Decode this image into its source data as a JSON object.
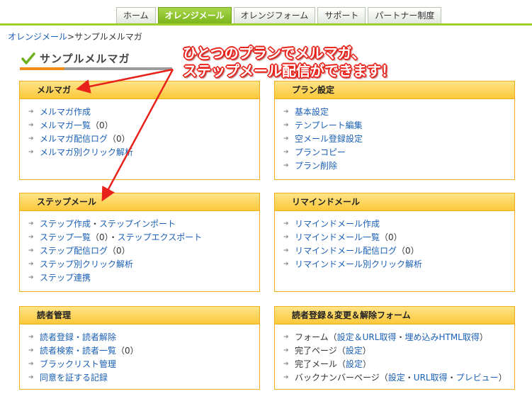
{
  "nav": {
    "tabs": [
      {
        "label": "ホーム"
      },
      {
        "label": "オレンジメール",
        "active": true
      },
      {
        "label": "オレンジフォーム"
      },
      {
        "label": "サポート"
      },
      {
        "label": "パートナー制度"
      }
    ]
  },
  "breadcrumb": {
    "root": "オレンジメール",
    "separator": ">",
    "current": "サンプルメルマガ"
  },
  "page": {
    "title": "サンプルメルマガ",
    "title_icon": "check-icon"
  },
  "annotation": {
    "line1": "ひとつのプランでメルマガ、",
    "line2": "ステップメール配信ができます！"
  },
  "panels": {
    "mailmag": {
      "title": "メルマガ",
      "items": [
        {
          "link": "メルマガ作成"
        },
        {
          "link": "メルマガ一覧",
          "suffix": "（0）"
        },
        {
          "link": "メルマガ配信ログ",
          "suffix": "（0）"
        },
        {
          "link": "メルマガ別クリック解析"
        }
      ]
    },
    "plan": {
      "title": "プラン設定",
      "items": [
        {
          "link": "基本設定"
        },
        {
          "link": "テンプレート編集"
        },
        {
          "link": "空メール登録設定"
        },
        {
          "link": "プランコピー"
        },
        {
          "link": "プラン削除"
        }
      ]
    },
    "step": {
      "title": "ステップメール",
      "items": [
        {
          "link": "ステップ作成",
          "mid": "・",
          "link2": "ステップインポート"
        },
        {
          "link": "ステップ一覧",
          "mid": "（0）・",
          "link2": "ステップエクスポート"
        },
        {
          "link": "ステップ配信ログ",
          "suffix": "（0）"
        },
        {
          "link": "ステップ別クリック解析"
        },
        {
          "link": "ステップ連携"
        }
      ]
    },
    "remind": {
      "title": "リマインドメール",
      "items": [
        {
          "link": "リマインドメール作成"
        },
        {
          "link": "リマインドメール一覧",
          "suffix": "（0）"
        },
        {
          "link": "リマインドメール配信ログ",
          "suffix": "（0）"
        },
        {
          "link": "リマインドメール別クリック解析"
        }
      ]
    },
    "readers": {
      "title": "読者管理",
      "items": [
        {
          "link": "読者登録・読者解除"
        },
        {
          "link": "読者検索・読者一覧",
          "suffix": "（0）"
        },
        {
          "link": "ブラックリスト管理"
        },
        {
          "link": "同意を証する記録"
        }
      ]
    },
    "forms": {
      "title": "読者登録＆変更＆解除フォーム",
      "items": [
        {
          "prefix": "フォーム（",
          "parts": [
            "設定＆URL取得",
            "・",
            "埋め込みHTML取得"
          ],
          "end": "）"
        },
        {
          "prefix": "完了ページ（",
          "parts": [
            "設定"
          ],
          "end": "）"
        },
        {
          "prefix": "完了メール（",
          "parts": [
            "設定"
          ],
          "end": "）"
        },
        {
          "prefix": "バックナンバーページ（",
          "parts": [
            "設定",
            "・",
            "URL取得",
            "・",
            "プレビュー"
          ],
          "end": "）"
        }
      ]
    }
  },
  "colors": {
    "accent_green": "#9fce2a",
    "panel_border": "#f2b01e",
    "panel_header": "#fbc83a",
    "link": "#1a5fb4",
    "annotation_red": "#e8221a"
  }
}
